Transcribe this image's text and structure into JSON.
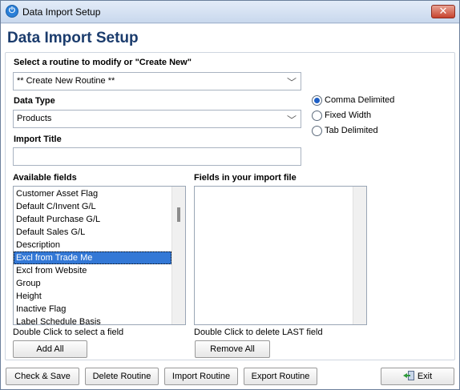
{
  "window": {
    "title": "Data Import Setup",
    "close_glyph": "✕",
    "icon": "power-icon"
  },
  "header": {
    "page_title": "Data Import Setup"
  },
  "routine": {
    "label": "Select a routine to modify or \"Create New\"",
    "value": "** Create New Routine **"
  },
  "data_type": {
    "label": "Data Type",
    "value": "Products"
  },
  "format": {
    "options": [
      "Comma Delimited",
      "Fixed Width",
      "Tab Delimited"
    ],
    "selected": "Comma Delimited"
  },
  "import_title": {
    "label": "Import Title",
    "value": ""
  },
  "available_fields": {
    "label": "Available fields",
    "items": [
      "Customer Asset Flag",
      "Default C/Invent G/L",
      "Default Purchase G/L",
      "Default Sales G/L",
      "Description",
      "Excl from Trade Me",
      "Excl from Website",
      "Group",
      "Height",
      "Inactive Flag",
      "Label Schedule Basis"
    ],
    "selected_index": 5,
    "hint": "Double Click to select a field",
    "add_all_label": "Add All"
  },
  "import_fields": {
    "label": "Fields in your import file",
    "items": [],
    "hint": "Double Click to delete LAST field",
    "remove_all_label": "Remove All"
  },
  "footer": {
    "check_save": "Check & Save",
    "delete_routine": "Delete Routine",
    "import_routine": "Import Routine",
    "export_routine": "Export Routine",
    "exit": "Exit"
  }
}
